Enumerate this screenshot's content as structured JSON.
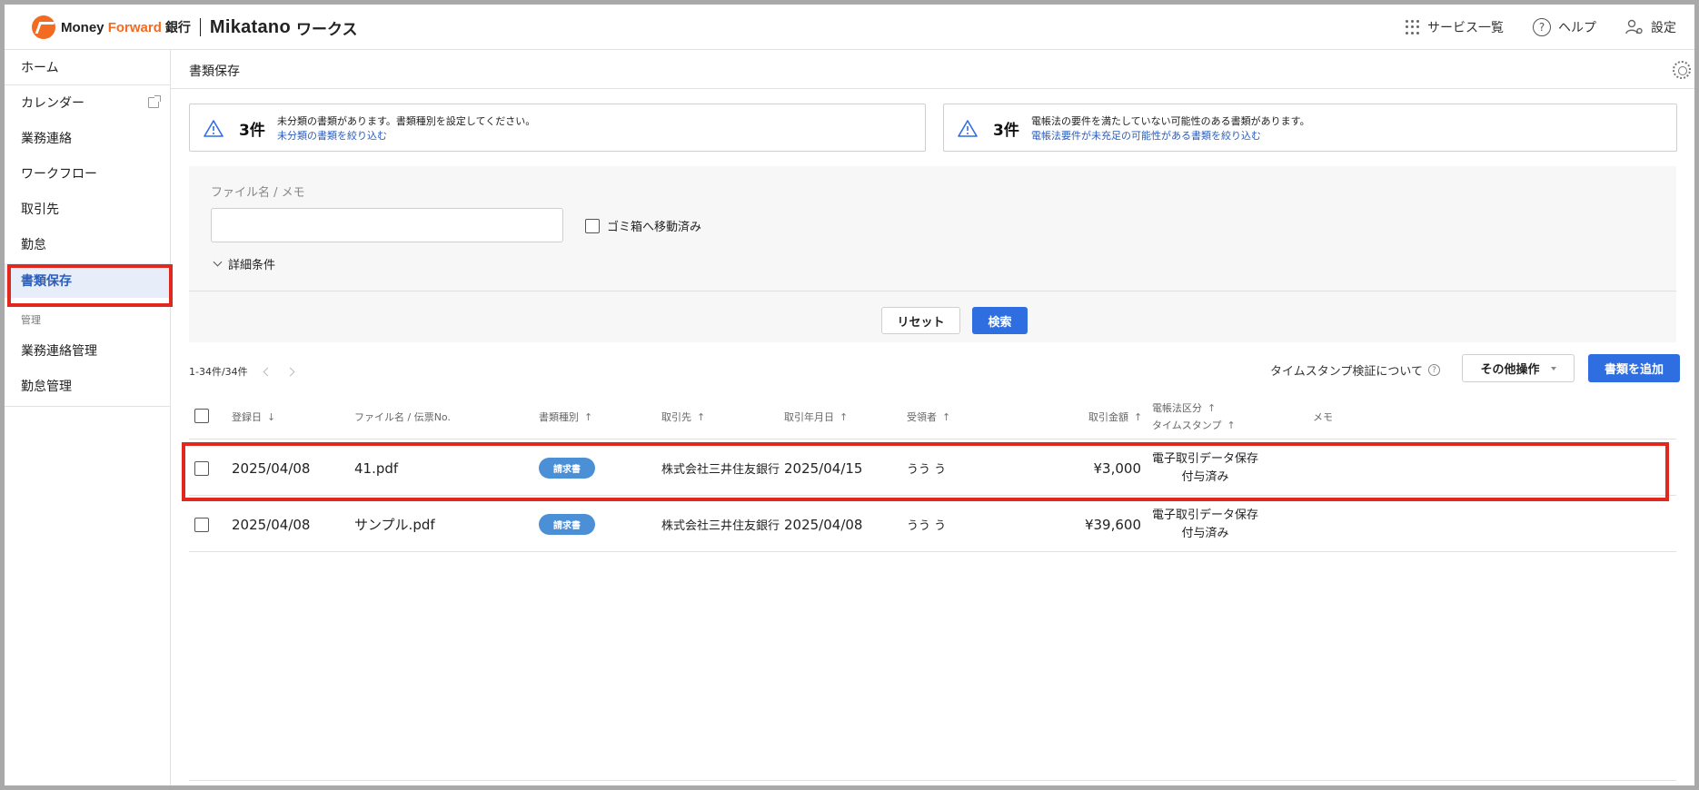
{
  "header": {
    "logo_brand_1": "Money ",
    "logo_brand_2": "Forward",
    "logo_bank": "銀行",
    "logo_product": "Mikatano",
    "logo_works": "ワークス",
    "services_label": "サービス一覧",
    "help_label": "ヘルプ",
    "help_icon_glyph": "?",
    "settings_label": "設定"
  },
  "sidebar": {
    "items": [
      {
        "label": "ホーム"
      },
      {
        "label": "カレンダー"
      },
      {
        "label": "業務連絡"
      },
      {
        "label": "ワークフロー"
      },
      {
        "label": "取引先"
      },
      {
        "label": "勤怠"
      },
      {
        "label": "書類保存"
      }
    ],
    "section_label": "管理",
    "admin_items": [
      {
        "label": "業務連絡管理"
      },
      {
        "label": "勤怠管理"
      }
    ],
    "active_item": "書類保存"
  },
  "page": {
    "title": "書類保存"
  },
  "notices": [
    {
      "count": "3件",
      "message": "未分類の書類があります。書類種別を設定してください。",
      "link": "未分類の書類を絞り込む"
    },
    {
      "count": "3件",
      "message": "電帳法の要件を満たしていない可能性のある書類があります。",
      "link": "電帳法要件が未充足の可能性がある書類を絞り込む"
    }
  ],
  "filter": {
    "label": "ファイル名 / メモ",
    "input_value": "",
    "trash_label": "ゴミ箱へ移動済み",
    "detail_label": "詳細条件",
    "reset_label": "リセット",
    "search_label": "検索"
  },
  "list": {
    "paging": "1-34件/34件",
    "timestamp_info": "タイムスタンプ検証について",
    "question_glyph": "?",
    "other_ops_label": "その他操作",
    "add_label": "書類を追加",
    "headers": {
      "date": "登録日",
      "date_arrow": "↓",
      "file": "ファイル名 / 伝票No.",
      "type": "書類種別",
      "partner": "取引先",
      "trade_date": "取引年月日",
      "receiver": "受領者",
      "amount": "取引金額",
      "law_1": "電帳法区分",
      "law_2": "タイムスタンプ",
      "memo": "メモ",
      "up_arrow": "↑"
    },
    "rows": [
      {
        "date": "2025/04/08",
        "file": "41.pdf",
        "type": "請求書",
        "partner": "株式会社三井住友銀行",
        "trade_date": "2025/04/15",
        "receiver": "うう う",
        "amount": "¥3,000",
        "law": "電子取引データ保存",
        "timestamp": "付与済み",
        "memo": ""
      },
      {
        "date": "2025/04/08",
        "file": "サンプル.pdf",
        "type": "請求書",
        "partner": "株式会社三井住友銀行",
        "trade_date": "2025/04/08",
        "receiver": "うう う",
        "amount": "¥39,600",
        "law": "電子取引データ保存",
        "timestamp": "付与済み",
        "memo": ""
      }
    ]
  },
  "colors": {
    "accent": "#2f6ee0",
    "highlight": "#e0281e",
    "badge": "#4b8fd6",
    "brand_orange": "#f26b21"
  }
}
